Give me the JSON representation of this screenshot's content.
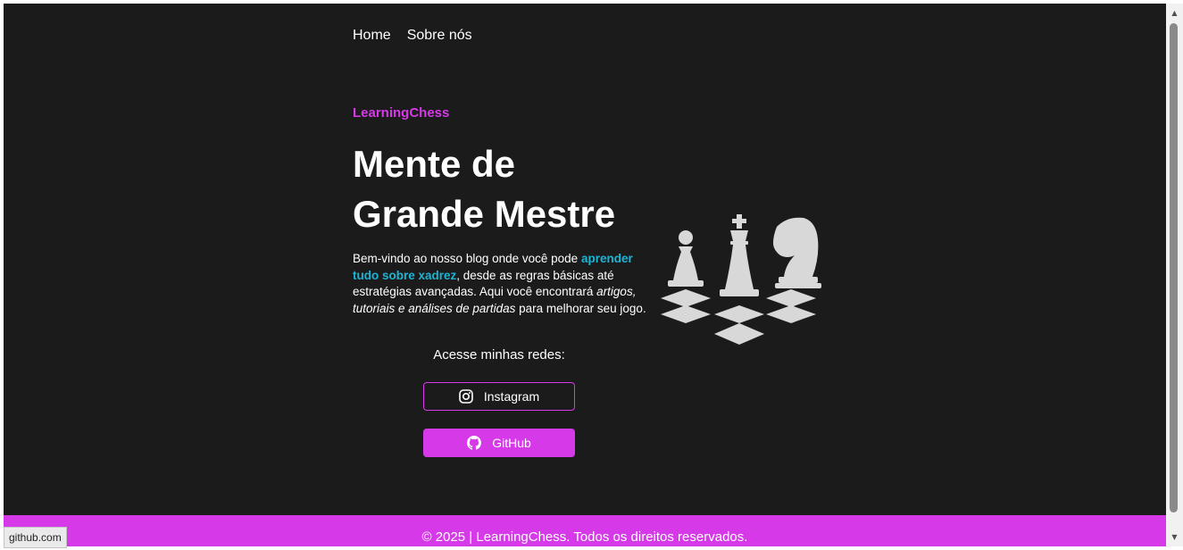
{
  "nav": {
    "items": [
      {
        "label": "Home"
      },
      {
        "label": "Sobre nós"
      }
    ]
  },
  "hero": {
    "brand": "LearningChess",
    "title_line1": "Mente de",
    "title_line2": "Grande Mestre",
    "intro": {
      "text1": "Bem-vindo ao nosso blog onde você pode ",
      "highlight": "aprender tudo sobre xadrez",
      "text2": ", desde as regras básicas até estratégias avançadas. Aqui você encontrará ",
      "emphasis": "artigos, tutoriais e análises de partidas",
      "text3": " para melhorar seu jogo."
    },
    "image": {
      "icon": "chess-pieces-illustration"
    }
  },
  "social": {
    "heading": "Acesse minhas redes:",
    "instagram": {
      "label": "Instagram",
      "icon": "instagram-icon"
    },
    "github": {
      "label": "GitHub",
      "icon": "github-icon"
    }
  },
  "footer": {
    "text": "© 2025  |  LearningChess. Todos os direitos reservados."
  },
  "status_bar": {
    "url": "github.com"
  },
  "colors": {
    "background": "#1b1b1b",
    "accent": "#d63ae8",
    "highlight": "#1ab5d6",
    "text": "#ffffff"
  }
}
